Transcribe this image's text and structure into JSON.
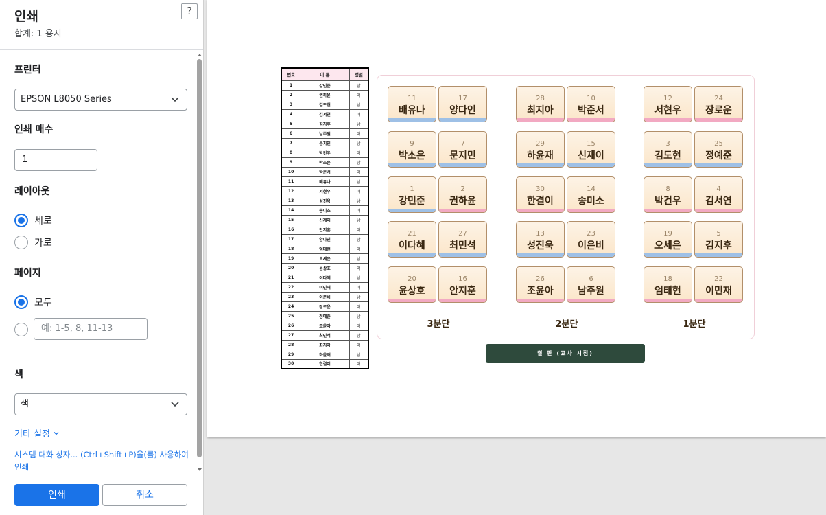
{
  "panel": {
    "title": "인쇄",
    "subtitle": "합계: 1 용지",
    "help": "?",
    "printer_label": "프린터",
    "printer_value": "EPSON L8050 Series",
    "copies_label": "인쇄 매수",
    "copies_value": "1",
    "layout_label": "레이아웃",
    "layout_portrait": "세로",
    "layout_landscape": "가로",
    "pages_label": "페이지",
    "pages_all": "모두",
    "pages_custom_placeholder": "예: 1-5, 8, 11-13",
    "color_label": "색",
    "color_value": "색",
    "more_settings": "기타 설정",
    "system_dialog": "시스템 대화 상자... (Ctrl+Shift+P)을(를) 사용하여 인쇄",
    "print_button": "인쇄",
    "cancel_button": "취소"
  },
  "colors": {
    "accent": "#1a73e8",
    "desk_male": "#9ec0e6",
    "desk_female": "#f2a9c2",
    "board": "#2e4a3c"
  },
  "roster": {
    "headers": [
      "번호",
      "이 름",
      "성별"
    ],
    "rows": [
      [
        "1",
        "강민준",
        "남"
      ],
      [
        "2",
        "권하윤",
        "여"
      ],
      [
        "3",
        "김도현",
        "남"
      ],
      [
        "4",
        "김서연",
        "여"
      ],
      [
        "5",
        "김지후",
        "남"
      ],
      [
        "6",
        "남주원",
        "여"
      ],
      [
        "7",
        "문지민",
        "남"
      ],
      [
        "8",
        "박건우",
        "여"
      ],
      [
        "9",
        "박소은",
        "남"
      ],
      [
        "10",
        "박준서",
        "여"
      ],
      [
        "11",
        "배유나",
        "남"
      ],
      [
        "12",
        "서현우",
        "여"
      ],
      [
        "13",
        "성진욱",
        "남"
      ],
      [
        "14",
        "송미소",
        "여"
      ],
      [
        "15",
        "신재이",
        "남"
      ],
      [
        "16",
        "안지훈",
        "여"
      ],
      [
        "17",
        "양다인",
        "남"
      ],
      [
        "18",
        "엄태현",
        "여"
      ],
      [
        "19",
        "오세은",
        "남"
      ],
      [
        "20",
        "윤상호",
        "여"
      ],
      [
        "21",
        "이다혜",
        "남"
      ],
      [
        "22",
        "이민재",
        "여"
      ],
      [
        "23",
        "이은비",
        "남"
      ],
      [
        "24",
        "장로운",
        "여"
      ],
      [
        "25",
        "정예준",
        "남"
      ],
      [
        "26",
        "조윤아",
        "여"
      ],
      [
        "27",
        "최민석",
        "남"
      ],
      [
        "28",
        "최지아",
        "여"
      ],
      [
        "29",
        "하윤재",
        "남"
      ],
      [
        "30",
        "한결이",
        "여"
      ]
    ]
  },
  "seating": {
    "sections": [
      "3분단",
      "2분단",
      "1분단"
    ],
    "desks": [
      [
        [
          {
            "n": "11",
            "name": "배유나",
            "g": "m"
          },
          {
            "n": "17",
            "name": "양다인",
            "g": "m"
          }
        ],
        [
          {
            "n": "9",
            "name": "박소은",
            "g": "m"
          },
          {
            "n": "7",
            "name": "문지민",
            "g": "m"
          }
        ],
        [
          {
            "n": "1",
            "name": "강민준",
            "g": "m"
          },
          {
            "n": "2",
            "name": "권하윤",
            "g": "f"
          }
        ],
        [
          {
            "n": "21",
            "name": "이다혜",
            "g": "m"
          },
          {
            "n": "27",
            "name": "최민석",
            "g": "m"
          }
        ],
        [
          {
            "n": "20",
            "name": "윤상호",
            "g": "f"
          },
          {
            "n": "16",
            "name": "안지훈",
            "g": "f"
          }
        ]
      ],
      [
        [
          {
            "n": "28",
            "name": "최지아",
            "g": "f"
          },
          {
            "n": "10",
            "name": "박준서",
            "g": "f"
          }
        ],
        [
          {
            "n": "29",
            "name": "하윤재",
            "g": "m"
          },
          {
            "n": "15",
            "name": "신재이",
            "g": "m"
          }
        ],
        [
          {
            "n": "30",
            "name": "한결이",
            "g": "f"
          },
          {
            "n": "14",
            "name": "송미소",
            "g": "f"
          }
        ],
        [
          {
            "n": "13",
            "name": "성진욱",
            "g": "m"
          },
          {
            "n": "23",
            "name": "이은비",
            "g": "m"
          }
        ],
        [
          {
            "n": "26",
            "name": "조윤아",
            "g": "f"
          },
          {
            "n": "6",
            "name": "남주원",
            "g": "f"
          }
        ]
      ],
      [
        [
          {
            "n": "12",
            "name": "서현우",
            "g": "f"
          },
          {
            "n": "24",
            "name": "장로운",
            "g": "f"
          }
        ],
        [
          {
            "n": "3",
            "name": "김도현",
            "g": "m"
          },
          {
            "n": "25",
            "name": "정예준",
            "g": "m"
          }
        ],
        [
          {
            "n": "8",
            "name": "박건우",
            "g": "f"
          },
          {
            "n": "4",
            "name": "김서연",
            "g": "f"
          }
        ],
        [
          {
            "n": "19",
            "name": "오세은",
            "g": "m"
          },
          {
            "n": "5",
            "name": "김지후",
            "g": "m"
          }
        ],
        [
          {
            "n": "18",
            "name": "엄태현",
            "g": "f"
          },
          {
            "n": "22",
            "name": "이민재",
            "g": "f"
          }
        ]
      ]
    ],
    "board": "칠 판 (교사 시점)"
  }
}
